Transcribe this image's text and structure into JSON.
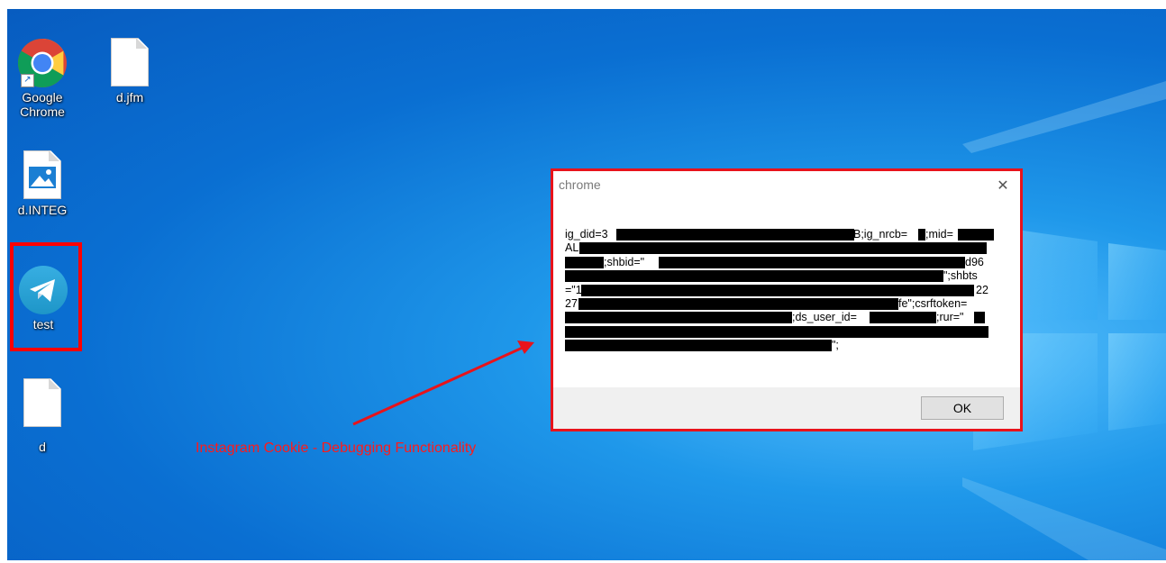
{
  "desktop": {
    "icons": [
      {
        "label_line1": "Google",
        "label_line2": "Chrome",
        "icon": "chrome-icon"
      },
      {
        "label": "d.jfm",
        "icon": "blank-file-icon"
      },
      {
        "label": "d.INTEG",
        "icon": "image-file-icon"
      },
      {
        "label": "test",
        "icon": "telegram-icon"
      },
      {
        "label": "d",
        "icon": "blank-file-icon"
      }
    ],
    "shortcut_overlay": "shortcut-arrow-icon"
  },
  "dialog": {
    "title": "chrome",
    "close_glyph": "✕",
    "message_visible_fragments": [
      "ig_did=3",
      "B;ig_nrcb=",
      ";mid=",
      "AL",
      ";shbid=\"",
      "d96",
      "\";shbts",
      "=\"1",
      "22",
      "27",
      "fe\";csrftoken=",
      ";ds_user_id=",
      ";rur=\"",
      "\";"
    ],
    "ok_label": "OK"
  },
  "annotation": {
    "text": "Instagram Cookie - Debugging Functionality",
    "color": "#ff1a1a"
  },
  "colors": {
    "highlight": "#ff0000",
    "desktop_blue": "#0a6fd2"
  }
}
